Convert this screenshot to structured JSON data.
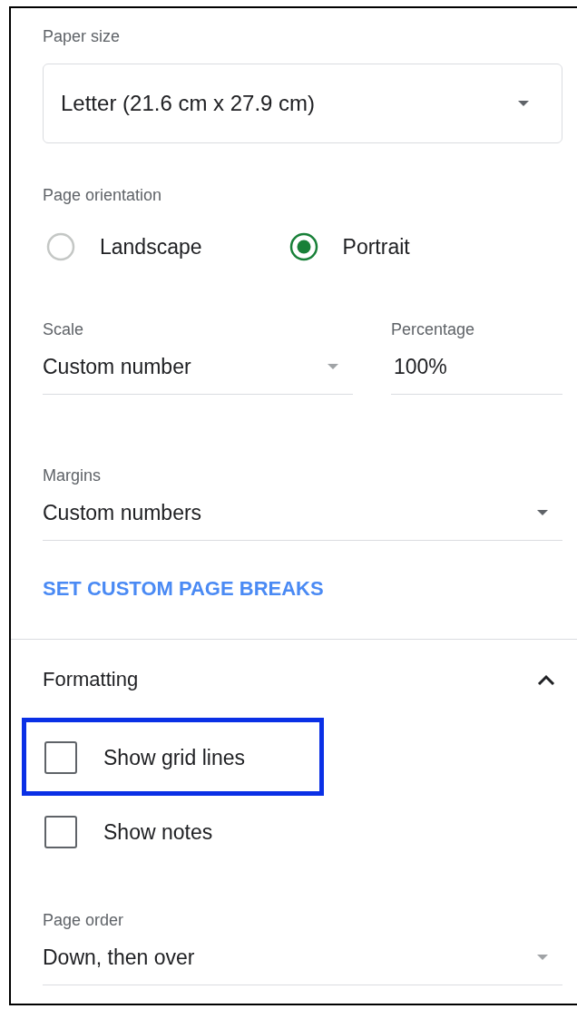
{
  "paper_size": {
    "label": "Paper size",
    "value": "Letter (21.6 cm x 27.9 cm)"
  },
  "orientation": {
    "label": "Page orientation",
    "options": [
      {
        "label": "Landscape",
        "selected": false
      },
      {
        "label": "Portrait",
        "selected": true
      }
    ]
  },
  "scale": {
    "label": "Scale",
    "value": "Custom number"
  },
  "percentage": {
    "label": "Percentage",
    "value": "100%"
  },
  "margins": {
    "label": "Margins",
    "value": "Custom numbers"
  },
  "page_breaks_link": "SET CUSTOM PAGE BREAKS",
  "formatting": {
    "title": "Formatting",
    "expanded": true,
    "options": [
      {
        "label": "Show grid lines",
        "checked": false,
        "highlighted": true
      },
      {
        "label": "Show notes",
        "checked": false,
        "highlighted": false
      }
    ]
  },
  "page_order": {
    "label": "Page order",
    "value": "Down, then over"
  }
}
